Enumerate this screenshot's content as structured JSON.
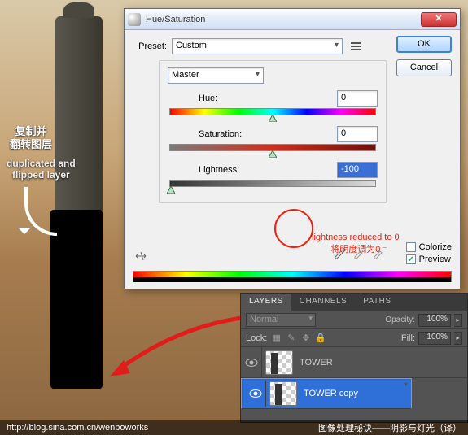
{
  "dialog": {
    "title": "Hue/Saturation",
    "ok": "OK",
    "cancel": "Cancel",
    "preset_label": "Preset:",
    "preset_value": "Custom",
    "channel": "Master",
    "hue": {
      "label": "Hue:",
      "value": "0"
    },
    "saturation": {
      "label": "Saturation:",
      "value": "0"
    },
    "lightness": {
      "label": "Lightness:",
      "value": "-100"
    },
    "colorize": "Colorize",
    "preview": "Preview",
    "preview_checked": true
  },
  "annotations": {
    "cn_dup": "复制并\n翻转图层",
    "en_dup": "duplicated and\nflipped layer",
    "red_en": "lightness reduced to 0",
    "red_cn": "将明度调为0"
  },
  "layers": {
    "tabs": [
      "LAYERS",
      "CHANNELS",
      "PATHS"
    ],
    "mode": "Normal",
    "opacity_label": "Opacity:",
    "opacity": "100%",
    "lock_label": "Lock:",
    "fill_label": "Fill:",
    "fill": "100%",
    "items": [
      {
        "name": "TOWER"
      },
      {
        "name": "TOWER copy"
      }
    ]
  },
  "footer": {
    "left": "http://blog.sina.com.cn/wenboworks",
    "right": "图像处理秘诀——阴影与灯光（译）"
  }
}
